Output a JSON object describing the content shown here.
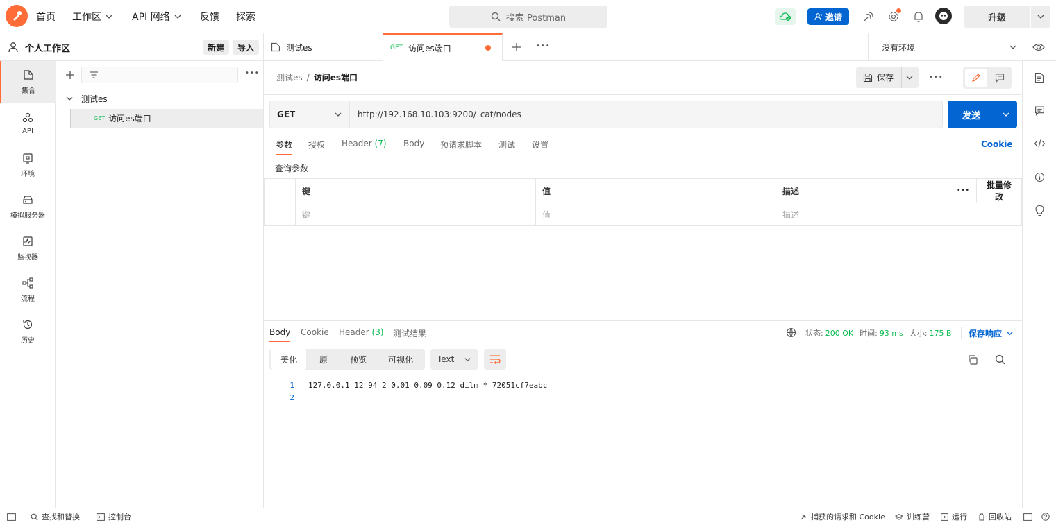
{
  "topbar": {
    "nav": [
      "首页",
      "工作区",
      "API 网络",
      "反馈",
      "探索"
    ],
    "search_placeholder": "搜索 Postman",
    "invite_label": "邀请",
    "upgrade_label": "升级",
    "colors": {
      "brand": "#ff6c37",
      "primary": "#0265d2"
    }
  },
  "workspace": {
    "title": "个人工作区",
    "new_label": "新建",
    "import_label": "导入"
  },
  "rail": {
    "items": [
      "集合",
      "API",
      "环境",
      "模拟服务器",
      "监视器",
      "流程",
      "历史"
    ]
  },
  "sidebar": {
    "collection": "测试es",
    "request": {
      "method": "GET",
      "name": "访问es端口"
    }
  },
  "tabs": [
    {
      "label": "测试es"
    },
    {
      "method": "GET",
      "label": "访问es端口"
    }
  ],
  "environment": "没有环境",
  "breadcrumb": {
    "parent": "测试es",
    "sep": "/",
    "current": "访问es端口"
  },
  "save_label": "保存",
  "request": {
    "method": "GET",
    "url": "http://192.168.10.103:9200/_cat/nodes",
    "send_label": "发送",
    "tabs": [
      "参数",
      "授权",
      "Header",
      "Body",
      "预请求脚本",
      "测试",
      "设置"
    ],
    "header_count": "(7)",
    "cookie_label": "Cookie",
    "query_title": "查询参数",
    "columns": {
      "key": "键",
      "value": "值",
      "desc": "描述",
      "more": "•••",
      "bulk": "批量修改"
    },
    "placeholders": {
      "key": "键",
      "value": "值",
      "desc": "描述"
    }
  },
  "response": {
    "tabs": [
      "Body",
      "Cookie",
      "Header",
      "测试结果"
    ],
    "header_count": "(3)",
    "status_label": "状态:",
    "status": "200 OK",
    "time_label": "时间:",
    "time": "93 ms",
    "size_label": "大小:",
    "size": "175 B",
    "save_label": "保存响应",
    "views": [
      "美化",
      "原",
      "预览",
      "可视化"
    ],
    "format": "Text",
    "lines": [
      {
        "n": "1",
        "text": "127.0.0.1 12 94 2 0.01 0.09 0.12 dilm * 72051cf7eabc"
      },
      {
        "n": "2",
        "text": ""
      }
    ]
  },
  "statusbar": {
    "find": "查找和替换",
    "console": "控制台",
    "capture": "捕获的请求和 Cookie",
    "bootcamp": "训练营",
    "runner": "运行",
    "trash": "回收站"
  }
}
